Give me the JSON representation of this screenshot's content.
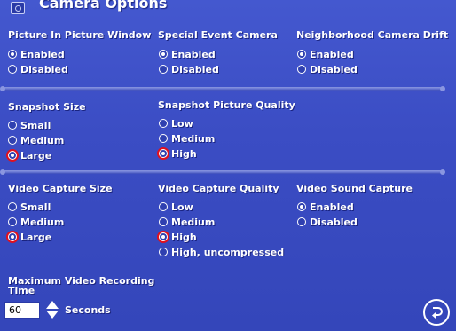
{
  "title": "Camera Options",
  "pip": {
    "title": "Picture In Picture Window",
    "options": [
      {
        "label": "Enabled",
        "selected": true
      },
      {
        "label": "Disabled",
        "selected": false
      }
    ]
  },
  "special_event": {
    "title": "Special Event Camera",
    "options": [
      {
        "label": "Enabled",
        "selected": true
      },
      {
        "label": "Disabled",
        "selected": false
      }
    ]
  },
  "neighborhood_drift": {
    "title": "Neighborhood Camera Drift",
    "options": [
      {
        "label": "Enabled",
        "selected": true
      },
      {
        "label": "Disabled",
        "selected": false
      }
    ]
  },
  "snapshot_size": {
    "title": "Snapshot Size",
    "options": [
      {
        "label": "Small",
        "selected": false
      },
      {
        "label": "Medium",
        "selected": false
      },
      {
        "label": "Large",
        "selected": true
      }
    ]
  },
  "snapshot_quality": {
    "title": "Snapshot Picture Quality",
    "options": [
      {
        "label": "Low",
        "selected": false
      },
      {
        "label": "Medium",
        "selected": false
      },
      {
        "label": "High",
        "selected": true
      }
    ]
  },
  "video_size": {
    "title": "Video Capture Size",
    "options": [
      {
        "label": "Small",
        "selected": false
      },
      {
        "label": "Medium",
        "selected": false
      },
      {
        "label": "Large",
        "selected": true
      }
    ]
  },
  "video_quality": {
    "title": "Video Capture Quality",
    "options": [
      {
        "label": "Low",
        "selected": false
      },
      {
        "label": "Medium",
        "selected": false
      },
      {
        "label": "High",
        "selected": true
      },
      {
        "label": "High, uncompressed",
        "selected": false
      }
    ]
  },
  "video_sound": {
    "title": "Video Sound Capture",
    "options": [
      {
        "label": "Enabled",
        "selected": true
      },
      {
        "label": "Disabled",
        "selected": false
      }
    ]
  },
  "max_recording": {
    "title_line1": "Maximum Video Recording",
    "title_line2": "Time",
    "value": "60",
    "unit": "Seconds"
  },
  "icons": {
    "title": "camera-icon",
    "stepper_up": "triangle-up-icon",
    "stepper_down": "triangle-down-icon",
    "undo": "undo-arrow-icon"
  },
  "colors": {
    "panel": "#3d4fc3",
    "text": "#ffffff",
    "highlight": "#e0101e"
  }
}
